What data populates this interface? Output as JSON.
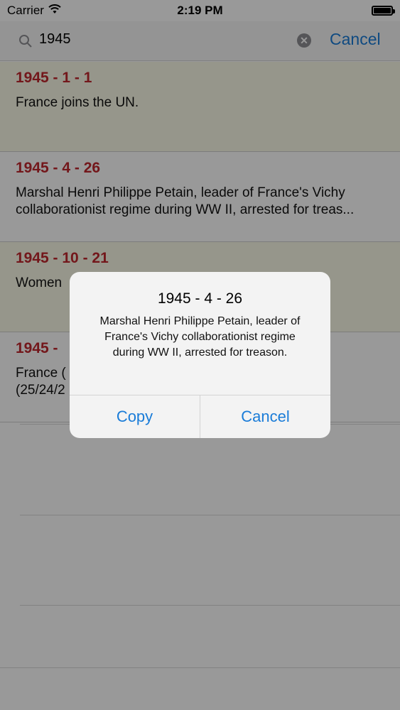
{
  "status_bar": {
    "carrier": "Carrier",
    "time": "2:19 PM"
  },
  "search": {
    "query": "1945",
    "cancel_label": "Cancel"
  },
  "events": [
    {
      "date": "1945 - 1 - 1",
      "text": "France joins the UN."
    },
    {
      "date": "1945 - 4 - 26",
      "text": "Marshal Henri Philippe Petain, leader of France's Vichy collaborationist regime during WW II, arrested for treas..."
    },
    {
      "date": "1945 - 10 - 21",
      "text": "Women"
    },
    {
      "date": "1945 -",
      "text": "France (\n(25/24/2"
    }
  ],
  "alert": {
    "title": "1945 - 4 - 26",
    "message": "Marshal Henri Philippe Petain, leader of France's Vichy collaborationist regime during WW II, arrested for treason.",
    "copy_label": "Copy",
    "cancel_label": "Cancel"
  }
}
